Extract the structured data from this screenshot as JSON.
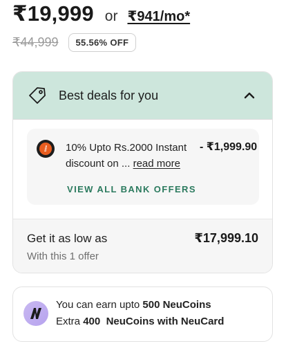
{
  "pricing": {
    "price": "₹19,999",
    "or_label": "or",
    "emi": "₹941/mo*",
    "mrp": "₹44,999",
    "discount": "55.56% OFF"
  },
  "deals": {
    "title": "Best deals for you",
    "offer": {
      "text": "10% Upto Rs.2000 Instant discount on ...",
      "read_more": "read more",
      "amount": "- ₹1,999.90"
    },
    "view_all_label": "VIEW ALL BANK OFFERS",
    "lowest": {
      "label": "Get it as low as",
      "sub": "With this 1 offer",
      "price": "₹17,999.10"
    }
  },
  "neucoins": {
    "line1_prefix": "You can earn upto ",
    "line1_bold": "500 NeuCoins",
    "line2_prefix": "Extra ",
    "line2_bold_a": "400",
    "line2_bold_b": "NeuCoins with NeuCard"
  },
  "colors": {
    "header_bg": "#cde6dc",
    "link_green": "#2b7a5e",
    "neu_purple": "#b7a3ef",
    "bank_orange": "#e85d1f"
  }
}
